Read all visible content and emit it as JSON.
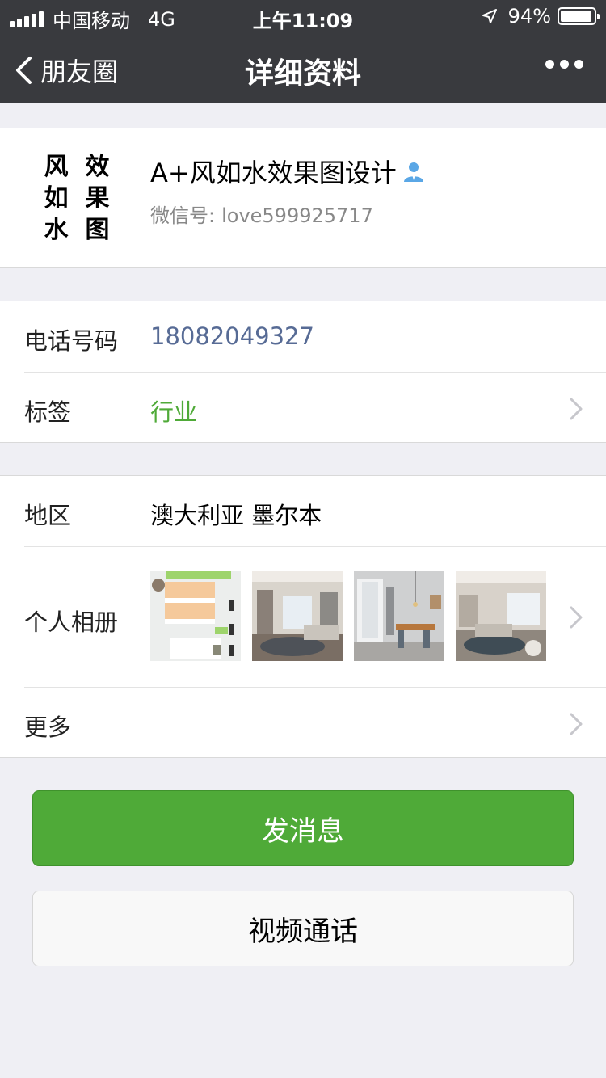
{
  "status_bar": {
    "carrier": "中国移动",
    "network": "4G",
    "time": "上午11:09",
    "battery": "94%",
    "battery_level": 0.94
  },
  "nav": {
    "back_label": "朋友圈",
    "title": "详细资料"
  },
  "profile": {
    "avatar_chars": [
      "风",
      "效",
      "如",
      "果",
      "水",
      "图"
    ],
    "name": "A+风如水效果图设计",
    "wechat_id_label": "微信号:",
    "wechat_id": "love599925717"
  },
  "info": {
    "phone_label": "电话号码",
    "phone": "18082049327",
    "tag_label": "标签",
    "tag": "行业",
    "region_label": "地区",
    "region": "澳大利亚 墨尔本",
    "album_label": "个人相册",
    "more_label": "更多"
  },
  "actions": {
    "message": "发消息",
    "video_call": "视频通话"
  },
  "colors": {
    "nav_bg": "#393a3e",
    "phone_text": "#576b95",
    "tag_text": "#4faa38",
    "primary_button": "#4faa38"
  }
}
